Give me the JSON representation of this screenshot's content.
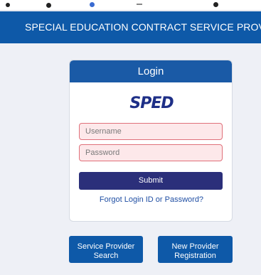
{
  "header": {
    "title": "SPECIAL EDUCATION CONTRACT SERVICE PROVIDE"
  },
  "login": {
    "title": "Login",
    "logo_text": "SPED",
    "username_placeholder": "Username",
    "password_placeholder": "Password",
    "submit_label": "Submit",
    "forgot_link": "Forgot Login ID or Password?"
  },
  "actions": {
    "search": {
      "line1": "Service Provider",
      "line2": "Search"
    },
    "register": {
      "line1": "New Provider",
      "line2": "Registration"
    }
  },
  "colors": {
    "header_bg": "#0e59a8",
    "card_header_bg": "#1a5aa6",
    "submit_bg": "#2b2f7a",
    "field_bg": "#fde8ea",
    "field_border": "#e0707a",
    "logo": "#1e2f87"
  }
}
